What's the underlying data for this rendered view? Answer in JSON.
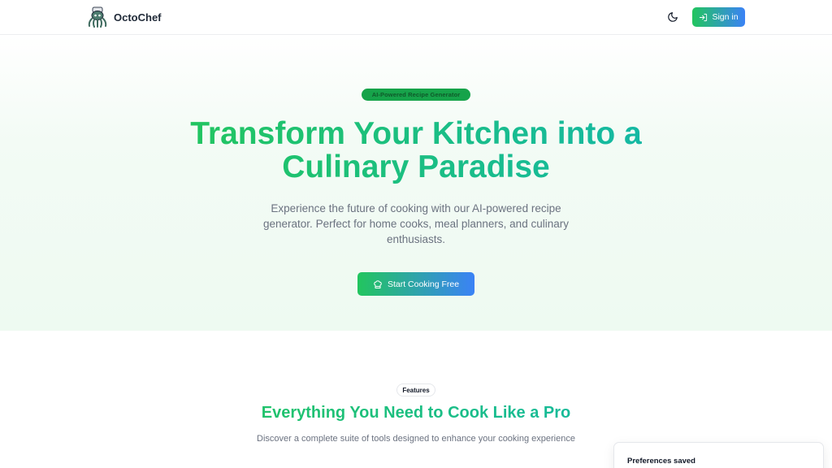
{
  "header": {
    "brand_name": "OctoChef",
    "signin_label": "Sign in",
    "theme_icon": "moon-icon",
    "signin_icon": "login-icon"
  },
  "hero": {
    "badge": "AI-Powered Recipe Generator",
    "title_line1": "Transform Your Kitchen into a",
    "title_line2": "Culinary Paradise",
    "subtitle": "Experience the future of cooking with our AI-powered recipe generator. Perfect for home cooks, meal planners, and culinary enthusiasts.",
    "cta_label": "Start Cooking Free",
    "cta_icon": "chef-hat-icon"
  },
  "features": {
    "badge": "Features",
    "title": "Everything You Need to Cook Like a Pro",
    "subtitle": "Discover a complete suite of tools designed to enhance your cooking experience"
  },
  "toast": {
    "title": "Preferences saved"
  },
  "colors": {
    "accent_green": "#22c55e",
    "accent_blue": "#3b82f6",
    "accent_teal": "#14b8a6",
    "hero_bg": "#eefaf1"
  }
}
